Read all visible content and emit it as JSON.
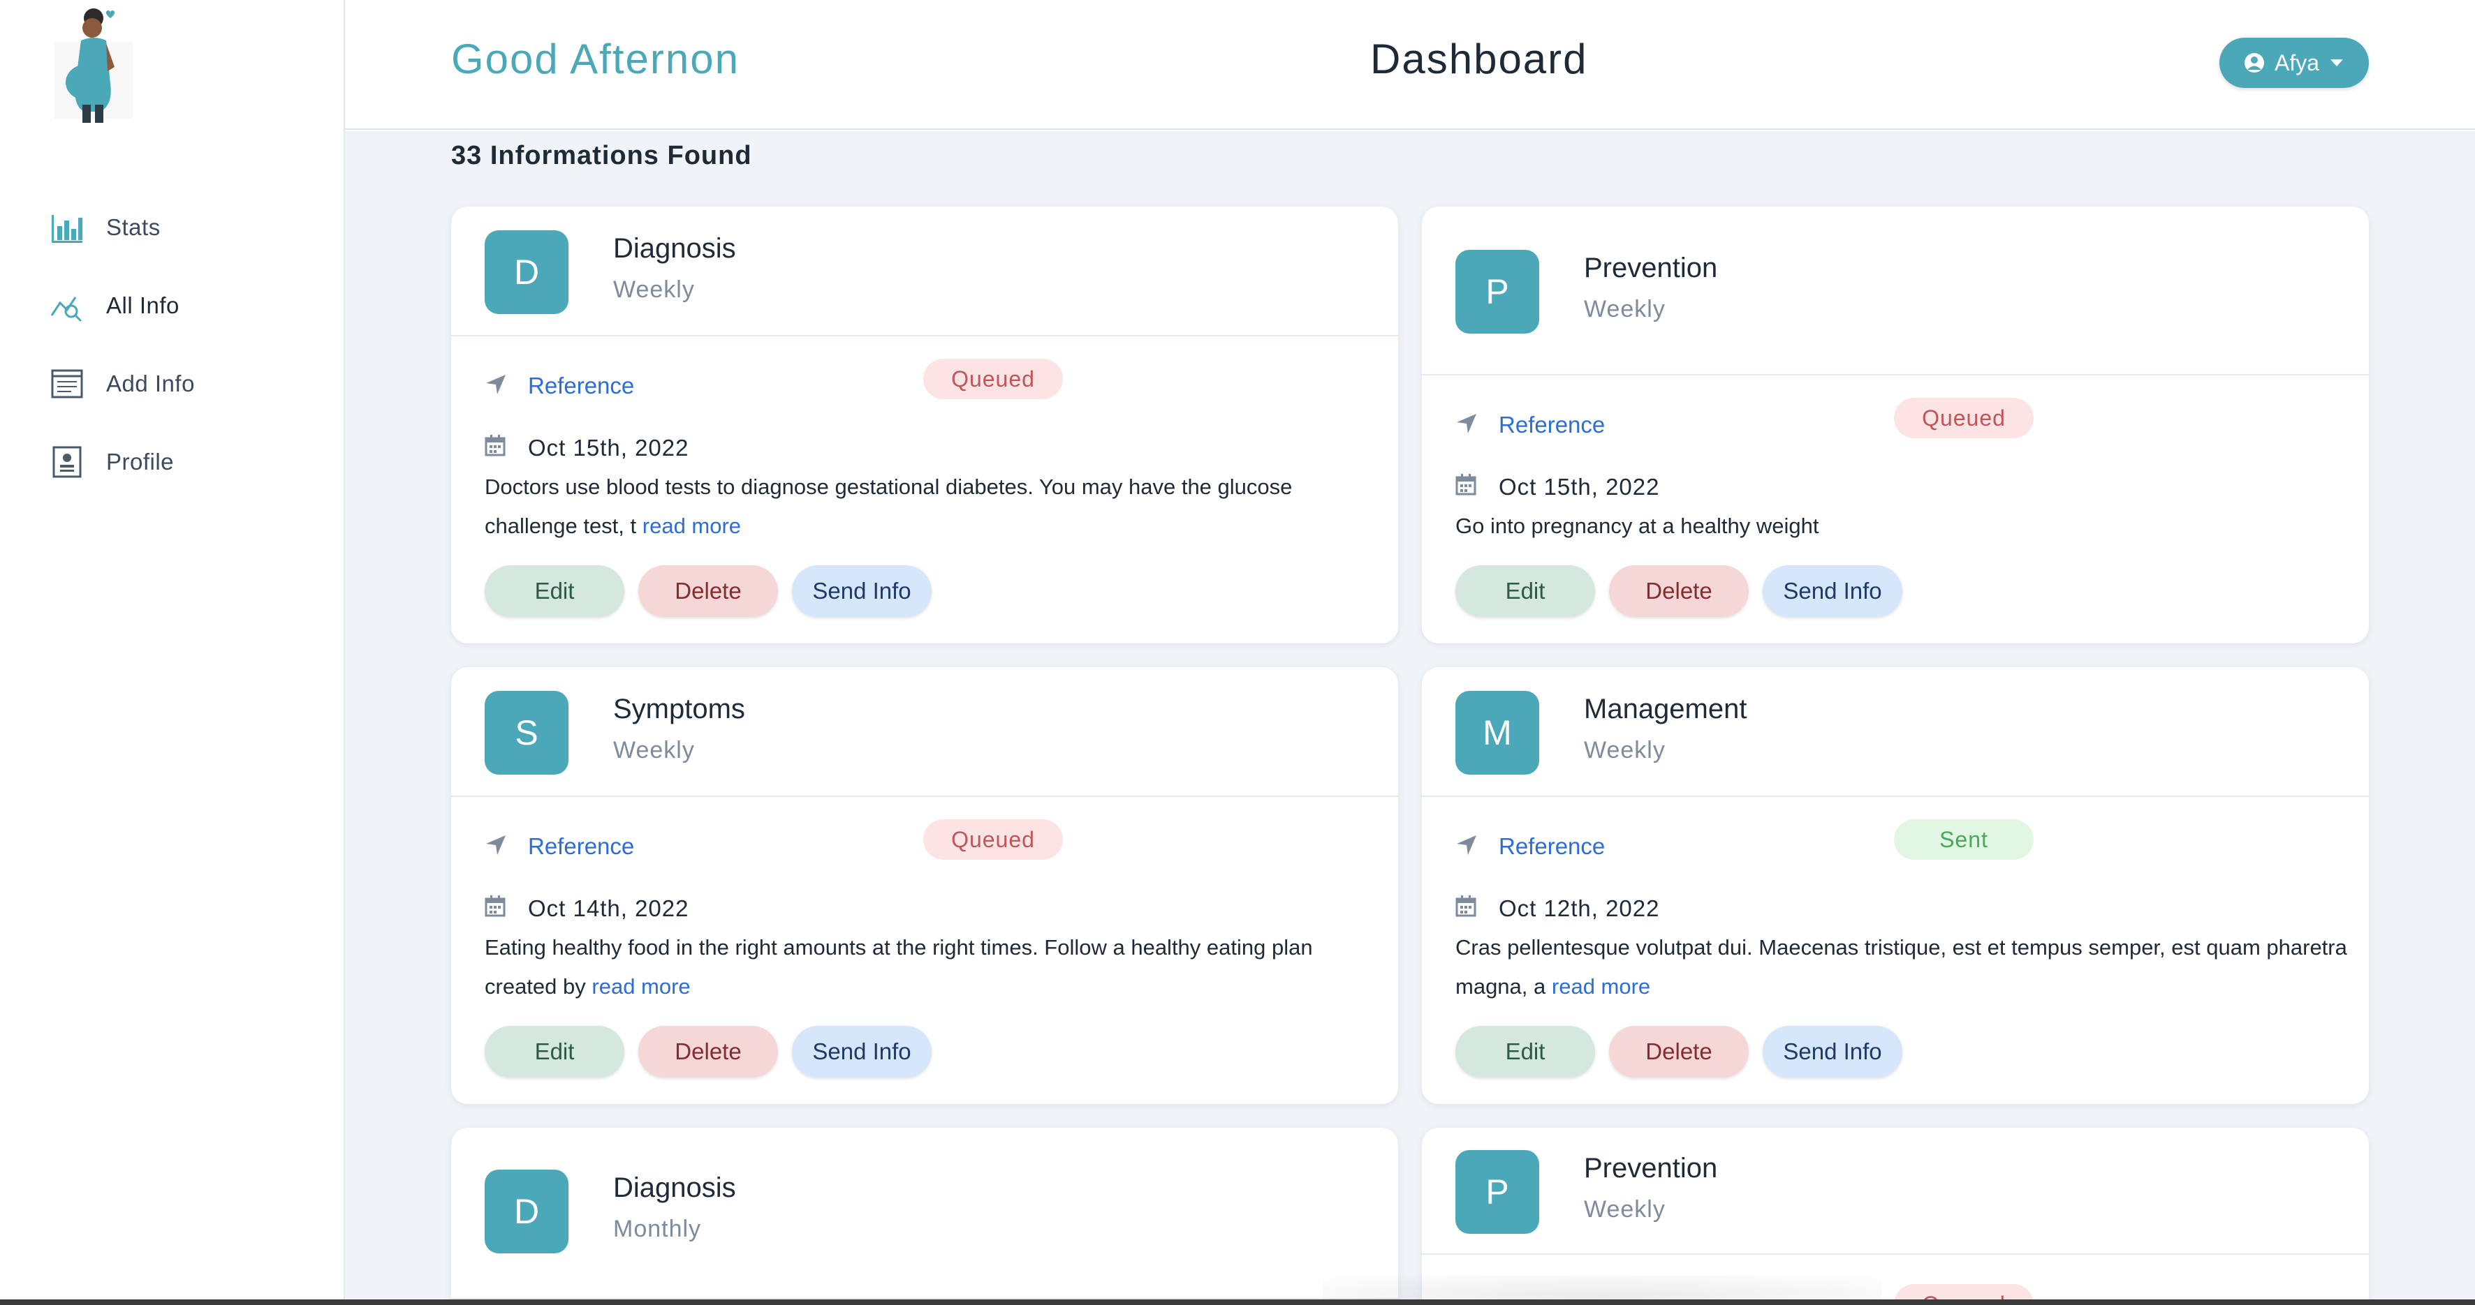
{
  "header": {
    "greeting": "Good Afternon",
    "title": "Dashboard",
    "user_name": "Afya"
  },
  "sidebar": {
    "items": [
      {
        "label": "Stats",
        "icon": "bar-chart-icon"
      },
      {
        "label": "All Info",
        "icon": "analytics-search-icon"
      },
      {
        "label": "Add Info",
        "icon": "form-icon"
      },
      {
        "label": "Profile",
        "icon": "profile-card-icon"
      }
    ]
  },
  "main": {
    "found_text": "33 Informations Found",
    "cards": [
      {
        "letter": "D",
        "title": "Diagnosis",
        "frequency": "Weekly",
        "reference": "Reference",
        "status": "Queued",
        "date": "Oct 15th, 2022",
        "description": "Doctors use blood tests to diagnose gestational diabetes. You may have the glucose challenge test, t",
        "read_more": "read more",
        "edit": "Edit",
        "delete": "Delete",
        "send": "Send Info"
      },
      {
        "letter": "P",
        "title": "Prevention",
        "frequency": "Weekly",
        "reference": "Reference",
        "status": "Queued",
        "date": "Oct 15th, 2022",
        "description": "Go into pregnancy at a healthy weight",
        "read_more": "",
        "edit": "Edit",
        "delete": "Delete",
        "send": "Send Info"
      },
      {
        "letter": "S",
        "title": "Symptoms",
        "frequency": "Weekly",
        "reference": "Reference",
        "status": "Queued",
        "date": "Oct 14th, 2022",
        "description": "Eating healthy food in the right amounts at the right times. Follow a healthy eating plan created by",
        "read_more": "read more",
        "edit": "Edit",
        "delete": "Delete",
        "send": "Send Info"
      },
      {
        "letter": "M",
        "title": "Management",
        "frequency": "Weekly",
        "reference": "Reference",
        "status": "Sent",
        "date": "Oct 12th, 2022",
        "description": "Cras pellentesque volutpat dui. Maecenas tristique, est et tempus semper, est quam pharetra magna, a",
        "read_more": "read more",
        "edit": "Edit",
        "delete": "Delete",
        "send": "Send Info"
      },
      {
        "letter": "D",
        "title": "Diagnosis",
        "frequency": "Monthly"
      },
      {
        "letter": "P",
        "title": "Prevention",
        "frequency": "Weekly",
        "status": "Queued"
      }
    ]
  },
  "colors": {
    "accent": "#4aa8b8",
    "link": "#2c6ed5",
    "queued_bg": "#fce4e4",
    "sent_bg": "#e2f6e4"
  }
}
